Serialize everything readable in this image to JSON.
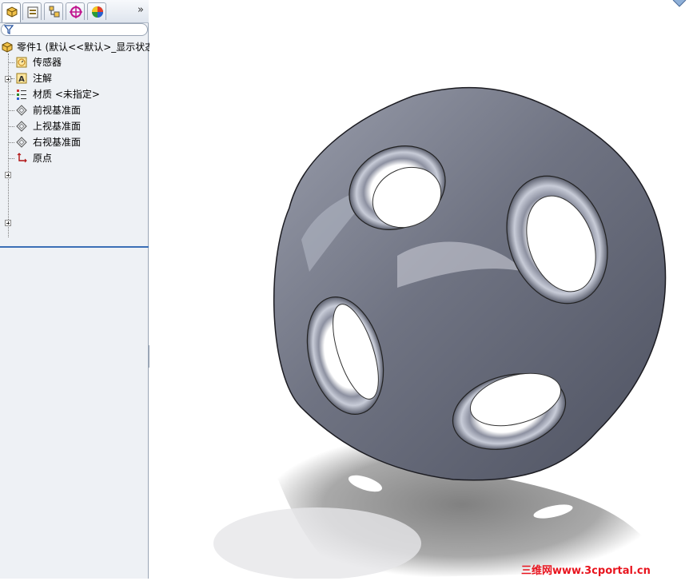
{
  "panel": {
    "tabs": [
      {
        "name": "feature-manager-icon"
      },
      {
        "name": "property-manager-icon"
      },
      {
        "name": "configuration-manager-icon"
      },
      {
        "name": "dimxpert-manager-icon"
      },
      {
        "name": "display-manager-icon"
      }
    ],
    "more_tabs": "»"
  },
  "tree": {
    "root": "零件1 (默认<<默认>_显示状态",
    "items": [
      {
        "label": "传感器",
        "icon": "sensor-icon"
      },
      {
        "label": "注解",
        "icon": "annotation-icon"
      },
      {
        "label": "材质 <未指定>",
        "icon": "material-icon"
      },
      {
        "label": "前视基准面",
        "icon": "plane-icon"
      },
      {
        "label": "上视基准面",
        "icon": "plane-icon"
      },
      {
        "label": "右视基准面",
        "icon": "plane-icon"
      },
      {
        "label": "原点",
        "icon": "origin-icon"
      }
    ]
  },
  "watermark": "三维网www.3cportal.cn",
  "colors": {
    "accent": "#3b6fb6",
    "panel": "#eef1f5",
    "model": "#6f7382",
    "watermark": "#e8141e"
  }
}
